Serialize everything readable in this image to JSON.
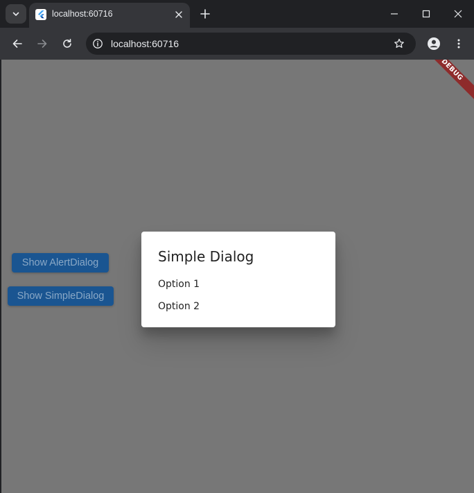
{
  "browser": {
    "tab": {
      "title": "localhost:60716"
    },
    "address_bar": {
      "url": "localhost:60716"
    },
    "icons": {
      "tab_search": "chevron-down-icon",
      "favicon": "flutter-logo-icon",
      "tab_close": "close-icon",
      "new_tab": "plus-icon",
      "minimize": "minimize-icon",
      "maximize": "maximize-icon",
      "close_window": "close-icon",
      "back": "arrow-left-icon",
      "forward": "arrow-right-icon",
      "reload": "reload-icon",
      "site_info": "info-icon",
      "bookmark": "star-icon",
      "profile": "profile-icon",
      "menu": "kebab-menu-icon"
    }
  },
  "app": {
    "debug_banner": "DEBUG",
    "buttons": {
      "show_alert_dialog": "Show AlertDialog",
      "show_simple_dialog": "Show SimpleDialog"
    },
    "dialog": {
      "title": "Simple Dialog",
      "options": [
        "Option 1",
        "Option 2"
      ]
    }
  },
  "colors": {
    "chrome_dark": "#202124",
    "toolbar": "#35363a",
    "barrier": "#777777",
    "button": "#1a5591",
    "debug_banner": "#8e2b2b",
    "dialog_bg": "#ffffff"
  }
}
